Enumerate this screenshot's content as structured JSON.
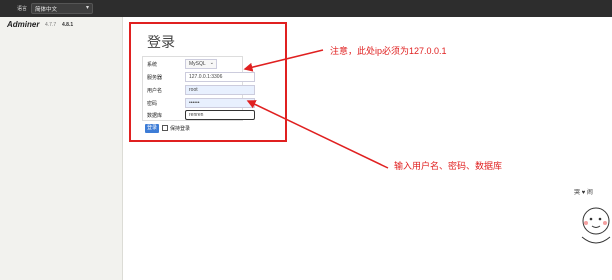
{
  "topbar": {
    "language_label": "语言",
    "language_value": "简体中文"
  },
  "sidebar": {
    "brand": "Adminer",
    "version": "4.7.7",
    "new_version": "4.8.1"
  },
  "login": {
    "title": "登录",
    "fields": {
      "system": {
        "label": "系统",
        "value": "MySQL"
      },
      "server": {
        "label": "服务器",
        "value": "127.0.0.1:3306"
      },
      "username": {
        "label": "用户名",
        "value": "root"
      },
      "password": {
        "label": "密码",
        "value": "••••••"
      },
      "database": {
        "label": "数据库",
        "value": "renren"
      }
    },
    "submit_label": "登录",
    "remember_label": "保持登录"
  },
  "annotations": {
    "note_server": "注意，此处ip必须为127.0.0.1",
    "note_inputs": "输入用户名、密码、数据库",
    "color": "#e02020"
  },
  "sticker": {
    "caption": "哭 ♥ 闹"
  }
}
